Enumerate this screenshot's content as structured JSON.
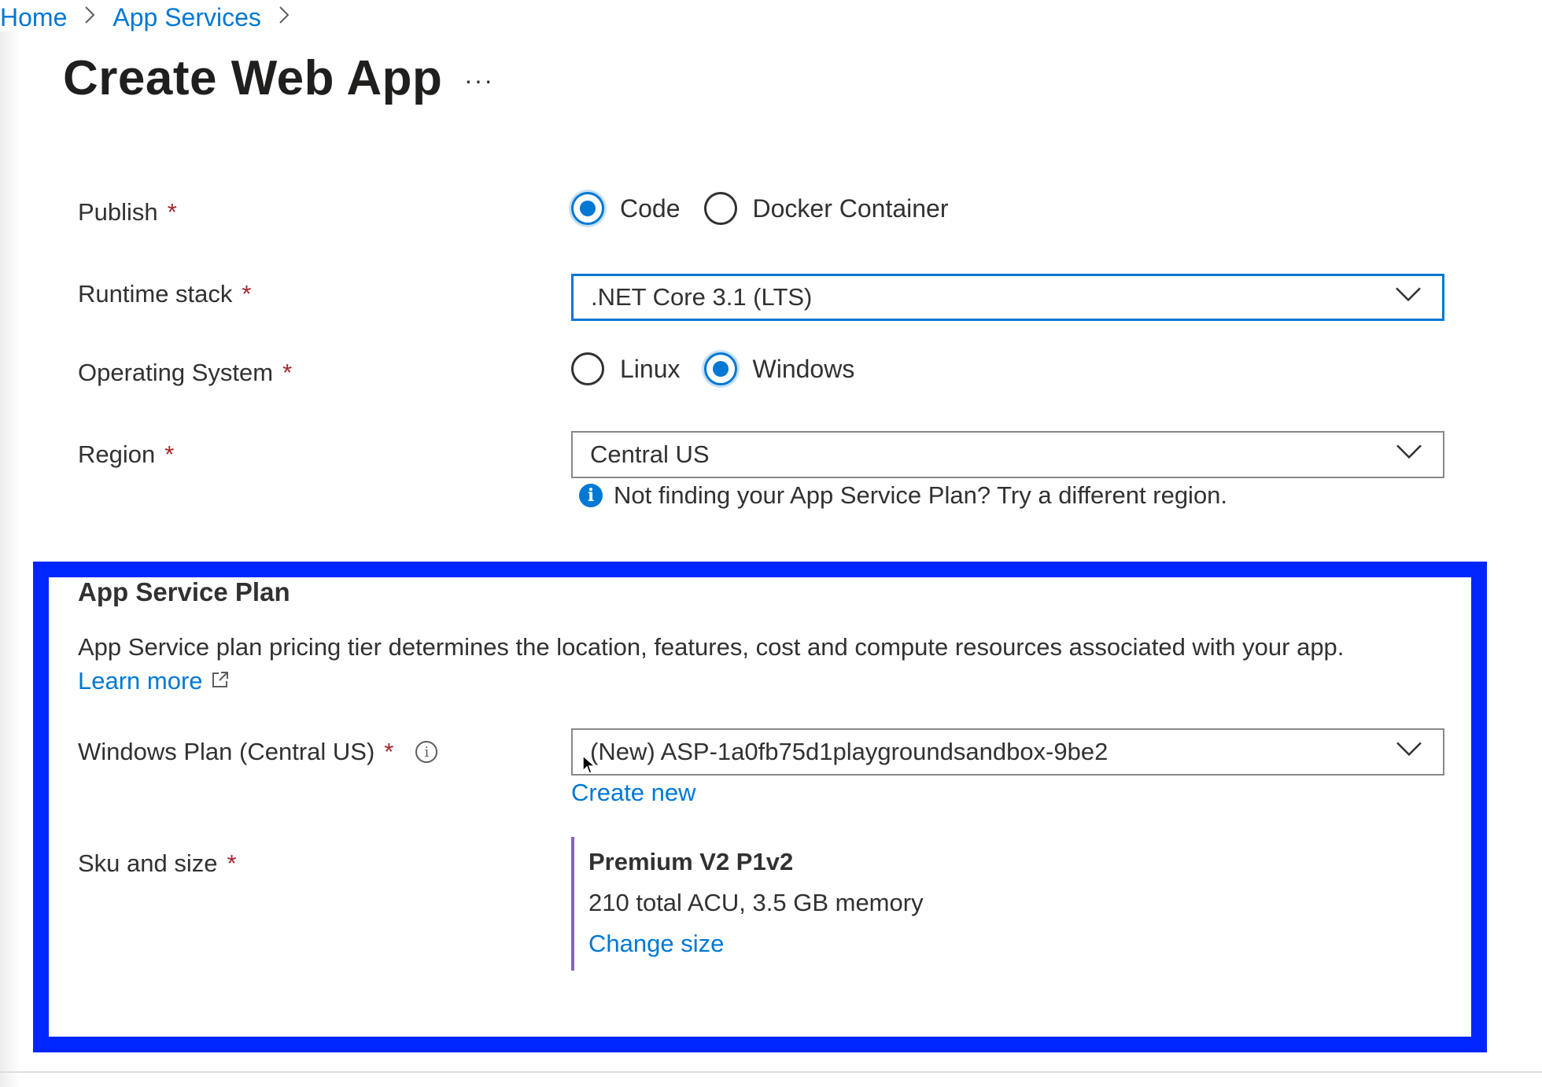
{
  "breadcrumb": {
    "home": "Home",
    "app_services": "App Services"
  },
  "page": {
    "title": "Create Web App",
    "more": "···"
  },
  "form": {
    "publish": {
      "label": "Publish",
      "options": [
        "Code",
        "Docker Container"
      ],
      "selected": "Code"
    },
    "runtime_stack": {
      "label": "Runtime stack",
      "value": ".NET Core 3.1 (LTS)"
    },
    "operating_system": {
      "label": "Operating System",
      "options": [
        "Linux",
        "Windows"
      ],
      "selected": "Windows"
    },
    "region": {
      "label": "Region",
      "value": "Central US",
      "info": "Not finding your App Service Plan? Try a different region."
    },
    "required_marker": "*"
  },
  "app_service_plan": {
    "title": "App Service Plan",
    "description": "App Service plan pricing tier determines the location, features, cost and compute resources associated with your app.",
    "learn_more": "Learn more",
    "windows_plan": {
      "label": "Windows Plan (Central US)",
      "value": "(New) ASP-1a0fb75d1playgroundsandbox-9be2",
      "create_new": "Create new"
    },
    "sku": {
      "label": "Sku and size",
      "name": "Premium V2 P1v2",
      "spec": "210 total ACU, 3.5 GB memory",
      "change_size": "Change size"
    }
  },
  "colors": {
    "accent": "#0078d4",
    "highlight": "#0026ff",
    "required": "#a4262c",
    "sku_bar": "#8661c5"
  },
  "icons": [
    "chevron-right-icon",
    "chevron-down-icon",
    "info-icon",
    "external-link-icon",
    "mouse-cursor-icon"
  ]
}
